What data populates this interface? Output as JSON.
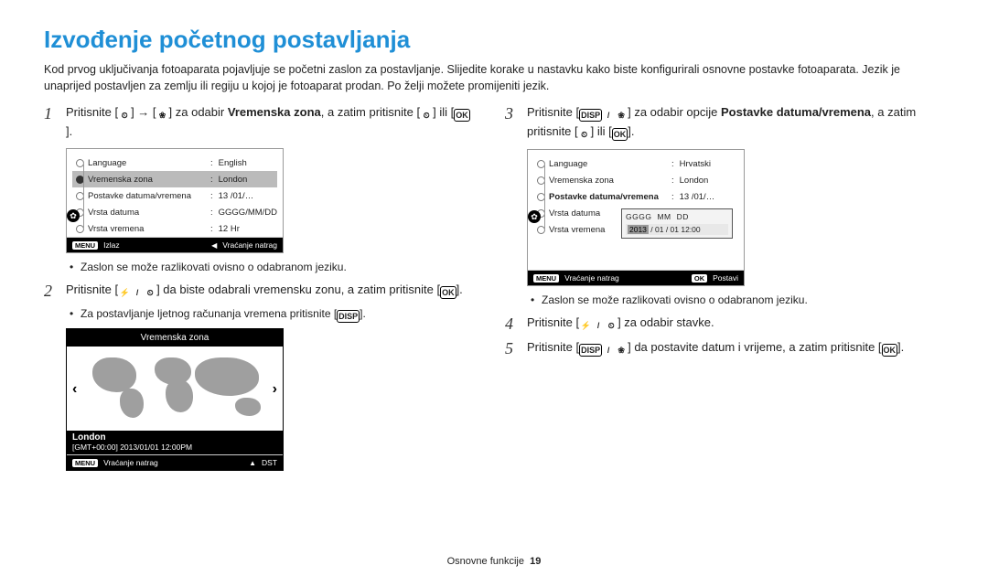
{
  "page": {
    "title": "Izvođenje početnog postavljanja",
    "intro": "Kod prvog uključivanja fotoaparata pojavljuje se početni zaslon za postavljanje. Slijedite korake u nastavku kako biste konfigurirali osnovne postavke fotoaparata. Jezik je unaprijed postavljen za zemlju ili regiju u kojoj je fotoaparat prodan. Po želji možete promijeniti jezik.",
    "footer_section": "Osnovne funkcije",
    "footer_page": "19"
  },
  "ic": {
    "timer": "⏲",
    "arrow_right": "→",
    "flower": "❀",
    "flash": "⚡",
    "ok": "OK",
    "disp": "DISP",
    "menu": "MENU",
    "slash": "/"
  },
  "left": {
    "step1_a": "Pritisnite [",
    "step1_b": "] → [",
    "step1_c": "] za odabir ",
    "step1_bold": "Vremenska zona",
    "step1_d": ", a zatim pritisnite [",
    "step1_e": "] ili [",
    "step1_f": "].",
    "note1": "Zaslon se može razlikovati ovisno o odabranom jeziku.",
    "step2_a": "Pritisnite [",
    "step2_b": "] da biste odabrali vremensku zonu, a zatim pritisnite [",
    "step2_c": "].",
    "note2": "Za postavljanje ljetnog računanja vremena pritisnite [",
    "note2_end": "].",
    "menu": {
      "rows": [
        {
          "label": "Language",
          "value": "English",
          "sel": false
        },
        {
          "label": "Vremenska zona",
          "value": "London",
          "sel": true
        },
        {
          "label": "Postavke datuma/vremena",
          "value": "13 /01/…",
          "sel": false
        },
        {
          "label": "Vrsta datuma",
          "value": "GGGG/MM/DD",
          "sel": false
        },
        {
          "label": "Vrsta vremena",
          "value": "12 Hr",
          "sel": false
        }
      ],
      "footer_left": "Izlaz",
      "footer_right": "Vraćanje natrag"
    },
    "map": {
      "title": "Vremenska zona",
      "city": "London",
      "time": "[GMT+00:00]     2013/01/01   12:00PM",
      "footer_left": "Vraćanje natrag",
      "footer_right": "DST"
    }
  },
  "right": {
    "step3_a": "Pritisnite [",
    "step3_b": "] za odabir opcije ",
    "step3_bold": "Postavke datuma/vremena",
    "step3_c": ", a zatim pritisnite [",
    "step3_d": "] ili [",
    "step3_e": "].",
    "note3": "Zaslon se može razlikovati ovisno o odabranom jeziku.",
    "menu": {
      "rows": [
        {
          "label": "Language",
          "value": "Hrvatski",
          "sel": false
        },
        {
          "label": "Vremenska zona",
          "value": "London",
          "sel": false
        },
        {
          "label": "Postavke datuma/vremena",
          "value": "13 /01/…",
          "sel": false,
          "bold": true
        },
        {
          "label": "Vrsta datuma",
          "value": "",
          "sel": false
        },
        {
          "label": "Vrsta vremena",
          "value": "",
          "sel": false
        }
      ],
      "footer_left": "Vraćanje natrag",
      "footer_right": "Postavi",
      "popup_hdr": [
        "GGGG",
        "MM",
        "DD"
      ],
      "popup_hi": "2013",
      "popup_rest": " / 01  / 01  12:00"
    },
    "step4_a": "Pritisnite [",
    "step4_b": "] za odabir stavke.",
    "step5_a": "Pritisnite [",
    "step5_b": "] da postavite datum i vrijeme, a zatim pritisnite [",
    "step5_c": "]."
  }
}
